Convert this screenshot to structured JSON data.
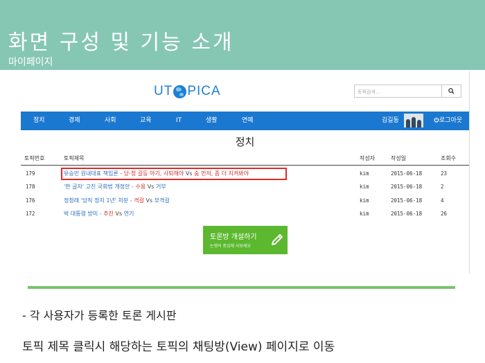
{
  "slide": {
    "title": "화면 구성 및 기능 소개",
    "subtitle": "마이페이지",
    "bullet": "- 각 사용자가 등록한 토론 게시판",
    "description": "토픽 제목 클릭시 해당하는 토픽의 채팅방(View) 페이지로 이동"
  },
  "app": {
    "logo": {
      "left": "UT",
      "right": "PICA"
    },
    "search": {
      "placeholder": "토픽검색...",
      "button_icon": "search-icon"
    },
    "nav": {
      "items": [
        "정치",
        "경제",
        "사회",
        "교육",
        "IT",
        "생활",
        "연예"
      ],
      "user_name": "김길동",
      "logout_label": "로그아웃",
      "logout_icon": "power-icon"
    },
    "page_title": "정치",
    "table": {
      "headers": [
        "토픽번호",
        "토픽제목",
        "작성자",
        "작성일",
        "조회수"
      ],
      "rows": [
        {
          "id": "179",
          "title": [
            "유승민 원내대표 책임론 - ",
            "당-청 갈등 야기, 사퇴해야",
            " Vs ",
            "숨 먼저, 좀 더 지켜봐야"
          ],
          "author": "kim",
          "date": "2015-06-18",
          "views": "23"
        },
        {
          "id": "178",
          "title": [
            "'한 글자' 고친 국회법 개정안 - ",
            "수용",
            " Vs ",
            "거부"
          ],
          "author": "kim",
          "date": "2015-06-18",
          "views": "2"
        },
        {
          "id": "176",
          "title": [
            "정청래 '당직 정지 1년' 처분 - ",
            "격걸",
            " Vs ",
            "부격걸"
          ],
          "author": "kim",
          "date": "2015-06-18",
          "views": "4"
        },
        {
          "id": "172",
          "title": [
            "박 대통령 방미 - ",
            "추진",
            " Vs ",
            "연기"
          ],
          "author": "kim",
          "date": "2015-06-18",
          "views": "26"
        }
      ]
    },
    "create_button": {
      "label": "토론방 개설하기",
      "sub_label": "논쟁의 중심에 서보세요",
      "icon": "pencil-icon"
    }
  },
  "colors": {
    "header_bg": "#86c7b3",
    "nav_bg": "#1b78d0",
    "button_bg": "#5cb82f",
    "highlight": "#e32828",
    "link": "#2a6ebd",
    "accent_red": "#d03030",
    "rule": "#79c46b"
  }
}
